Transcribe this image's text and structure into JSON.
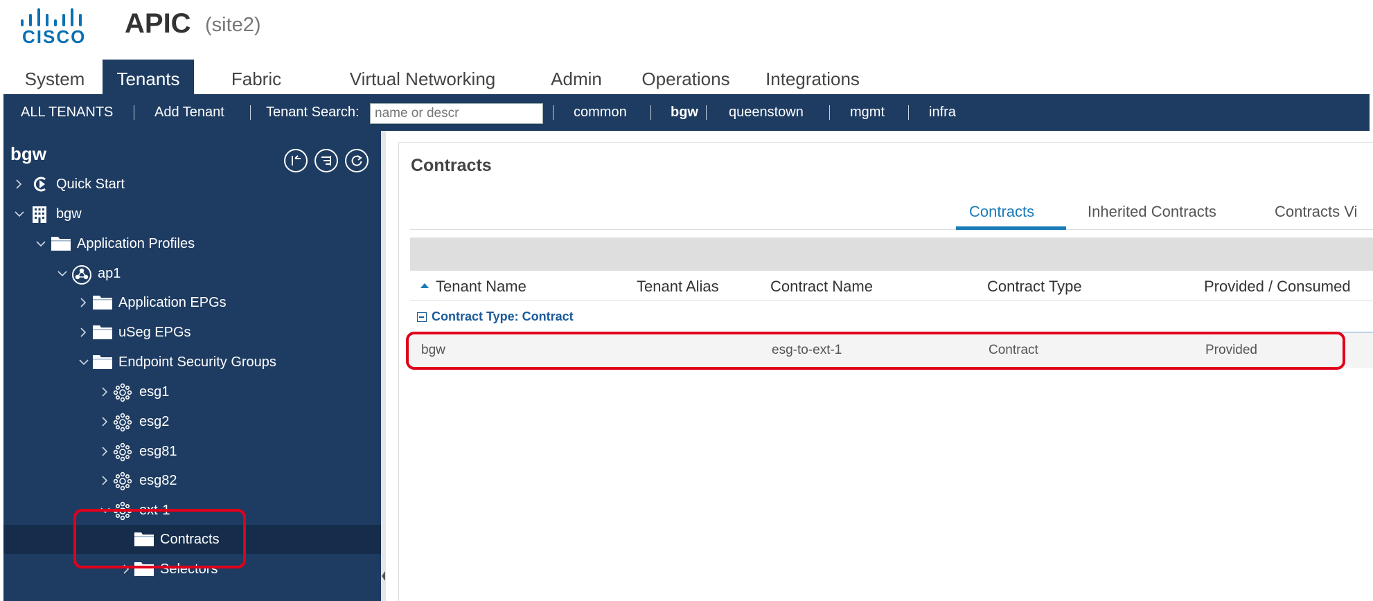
{
  "app": {
    "title": "APIC",
    "site": "(site2)",
    "logo_text": "CISCO"
  },
  "main_tabs": [
    {
      "label": "System",
      "active": false
    },
    {
      "label": "Tenants",
      "active": true
    },
    {
      "label": "Fabric",
      "active": false
    },
    {
      "label": "Virtual Networking",
      "active": false
    },
    {
      "label": "Admin",
      "active": false
    },
    {
      "label": "Operations",
      "active": false
    },
    {
      "label": "Integrations",
      "active": false
    }
  ],
  "tenant_bar": {
    "all_tenants": "ALL TENANTS",
    "add_tenant": "Add Tenant",
    "search_label": "Tenant Search:",
    "search_placeholder": "name or descr",
    "tenants": [
      "common",
      "bgw",
      "queenstown",
      "mgmt",
      "infra"
    ],
    "active_tenant": "bgw"
  },
  "nav": {
    "title": "bgw",
    "tools": [
      "collapse-tree-icon",
      "filter-list-icon",
      "refresh-icon"
    ],
    "tree": [
      {
        "label": "Quick Start",
        "icon": "quick-start-icon",
        "expanded": false
      },
      {
        "label": "bgw",
        "icon": "building-icon",
        "expanded": true
      },
      {
        "label": "Application Profiles",
        "icon": "folder-icon",
        "expanded": true
      },
      {
        "label": "ap1",
        "icon": "app-profile-icon",
        "expanded": true
      },
      {
        "label": "Application EPGs",
        "icon": "folder-icon",
        "expanded": false
      },
      {
        "label": "uSeg EPGs",
        "icon": "folder-icon",
        "expanded": false
      },
      {
        "label": "Endpoint Security Groups",
        "icon": "folder-icon",
        "expanded": true
      },
      {
        "label": "esg1",
        "icon": "esg-icon",
        "expanded": false
      },
      {
        "label": "esg2",
        "icon": "esg-icon",
        "expanded": false
      },
      {
        "label": "esg81",
        "icon": "esg-icon",
        "expanded": false
      },
      {
        "label": "esg82",
        "icon": "esg-icon",
        "expanded": false
      },
      {
        "label": "ext-1",
        "icon": "esg-icon",
        "expanded": true
      },
      {
        "label": "Contracts",
        "icon": "folder-icon",
        "selected": true
      },
      {
        "label": "Selectors",
        "icon": "folder-icon",
        "expanded": false
      }
    ]
  },
  "content": {
    "title": "Contracts",
    "tabs": [
      {
        "label": "Contracts",
        "active": true
      },
      {
        "label": "Inherited Contracts",
        "active": false
      },
      {
        "label": "Contracts Vi",
        "active": false
      }
    ],
    "columns": [
      "Tenant Name",
      "Tenant Alias",
      "Contract Name",
      "Contract Type",
      "Provided / Consumed"
    ],
    "group_label": "Contract Type: Contract",
    "rows": [
      {
        "tenant_name": "bgw",
        "tenant_alias": "",
        "contract_name": "esg-to-ext-1",
        "contract_type": "Contract",
        "provided_consumed": "Provided"
      }
    ]
  },
  "colors": {
    "navy": "#1e3c62",
    "nav_selected": "#152d4b",
    "accent_blue": "#1a7bb9",
    "cisco_blue": "#0a70b4",
    "highlight_red": "#e0001b"
  }
}
